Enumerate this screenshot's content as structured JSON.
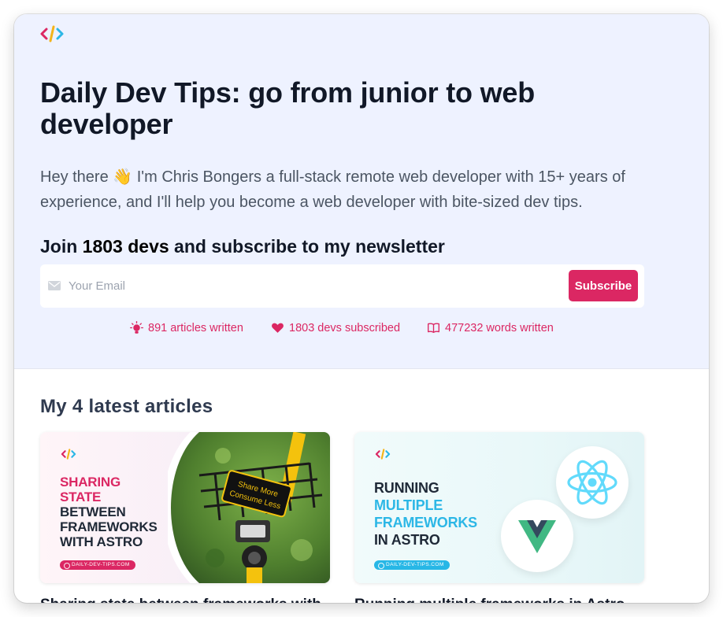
{
  "brand": {
    "logo_icon": "code-brackets-logo"
  },
  "hero": {
    "title": "Daily Dev Tips: go from junior to web developer",
    "intro": "Hey there 👋 I'm Chris Bongers a full-stack remote web developer with 15+ years of experience, and I'll help you become a web developer with bite-sized dev tips.",
    "join_prefix": "Join ",
    "join_count": "1803 devs",
    "join_suffix": " and subscribe to my newsletter"
  },
  "newsletter": {
    "email_placeholder": "Your Email",
    "email_value": "",
    "subscribe_label": "Subscribe"
  },
  "stats": [
    {
      "icon": "lightbulb-icon",
      "text": "891 articles written"
    },
    {
      "icon": "heart-icon",
      "text": "1803 devs subscribed"
    },
    {
      "icon": "book-open-icon",
      "text": "477232 words written"
    }
  ],
  "latest": {
    "title": "My 4 latest articles",
    "cards": [
      {
        "headline_lines": [
          {
            "text": "SHARING",
            "style": "pink"
          },
          {
            "text": "STATE",
            "style": "pink"
          },
          {
            "text": "BETWEEN",
            "style": "dark"
          },
          {
            "text": "FRAMEWORKS",
            "style": "dark"
          },
          {
            "text": "WITH ASTRO",
            "style": "dark"
          }
        ],
        "badge": "DAILY-DEV-TIPS.COM",
        "sign_text": "Share More Consume Less",
        "caption": "Sharing state between frameworks with"
      },
      {
        "headline_lines": [
          {
            "text": "RUNNING",
            "style": "dark"
          },
          {
            "text": "MULTIPLE",
            "style": "cyan"
          },
          {
            "text": "FRAMEWORKS",
            "style": "cyan"
          },
          {
            "text": "IN ASTRO",
            "style": "dark"
          }
        ],
        "badge": "DAILY-DEV-TIPS.COM",
        "caption": "Running multiple frameworks in Astro"
      }
    ]
  },
  "colors": {
    "accent": "#db2763",
    "hero_bg": "#eef2ff",
    "cyan": "#2cb7e6",
    "react": "#61dafb",
    "vue_green": "#41b883",
    "vue_dark": "#34495e"
  }
}
